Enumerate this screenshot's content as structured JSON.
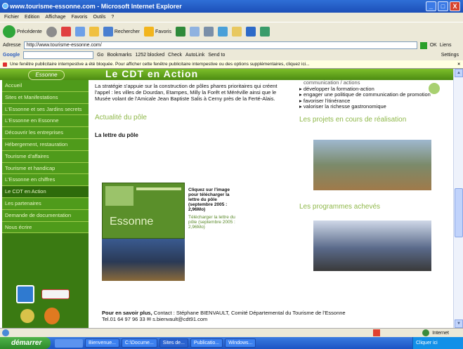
{
  "window": {
    "title": "www.tourisme-essonne.com - Microsoft Internet Explorer",
    "buttons": [
      "_",
      "□",
      "X"
    ]
  },
  "menu": [
    "Fichier",
    "Edition",
    "Affichage",
    "Favoris",
    "Outils",
    "?"
  ],
  "toolbar": {
    "back": "Précédente",
    "search": "Rechercher",
    "favorites": "Favoris"
  },
  "address": {
    "label": "Adresse",
    "url": "http://www.tourisme-essonne.com/",
    "go": "OK",
    "links": "Liens"
  },
  "googlebar": {
    "label": "Google",
    "go": "Go",
    "bookmarks": "Bookmarks",
    "blocked": "1252 blocked",
    "check": "Check",
    "autolink": "AutoLink",
    "send": "Send to",
    "settings": "Settings"
  },
  "popup": {
    "message": "Une fenêtre publicitaire intempestive a été bloquée. Pour afficher cette fenêtre publicitaire intempestive ou des options supplémentaires, cliquez ici..."
  },
  "page": {
    "banner": "Le CDT en Action",
    "logo": "Essonne",
    "nav": [
      "Accueil",
      "Sites et Manifestations",
      "L'Essonne et ses Jardins secrets",
      "L'Essonne en Essonne",
      "Découvrir les entreprises",
      "Hébergement, restauration",
      "Tourisme d'affaires",
      "Tourisme et handicap",
      "L'Essonne en chiffres",
      "Le CDT en Action",
      "Les partenaires",
      "Demande de documentation",
      "Nous écrire"
    ],
    "intro": "La stratégie s'appuie sur la construction de pôles phares prioritaires qui créent l'appel : les villes de Dourdan, Etampes, Milly la Forêt et Méréville ainsi que le Musée volant de l'Amicale Jean Baptiste Salis à Cerny près de la Ferté-Alais.",
    "section_heading": "Actualité du pôle",
    "letter_heading": "La lettre du pôle",
    "download_text": "Cliquez sur l'image pour télécharger la lettre du pôle (septembre 2005 : 2,96Mo)",
    "dl_link": "Télécharger la lettre du pôle (septembre 2005 : 2,96Mo)",
    "brochure_title": "Essonne",
    "right_bullets_intro": "communication / actions",
    "right_bullets": [
      "développer la formation-action",
      "engager une politique de communication de promotion",
      "favoriser l'itinérance",
      "valoriser la richesse gastronomique"
    ],
    "projects_heading": "Les projets en cours de réalisation",
    "programs_heading": "Les programmes achevés",
    "footer_bold": "Pour en savoir plus,",
    "footer_text": " Contact : Stéphane BIENVAULT, Comité Départemental du Tourisme de l'Essonne",
    "footer_tel": "Tel.01 64 97 96 33 ✉ s.bienvault@cdt91.com"
  },
  "status": {
    "left": "",
    "zone": "Internet"
  },
  "taskbar": {
    "start": "démarrer",
    "tasks": [
      "Bienvenue...",
      "C:\\Docume...",
      "Sites de...",
      "Publicatio...",
      "Windows..."
    ],
    "clock": "Cliquer ici"
  },
  "colors": {
    "green_nav": "#4f9b1b",
    "banner": "#7dbf2a",
    "heading": "#8fb84a",
    "titlebar": "#2f6fd6"
  }
}
